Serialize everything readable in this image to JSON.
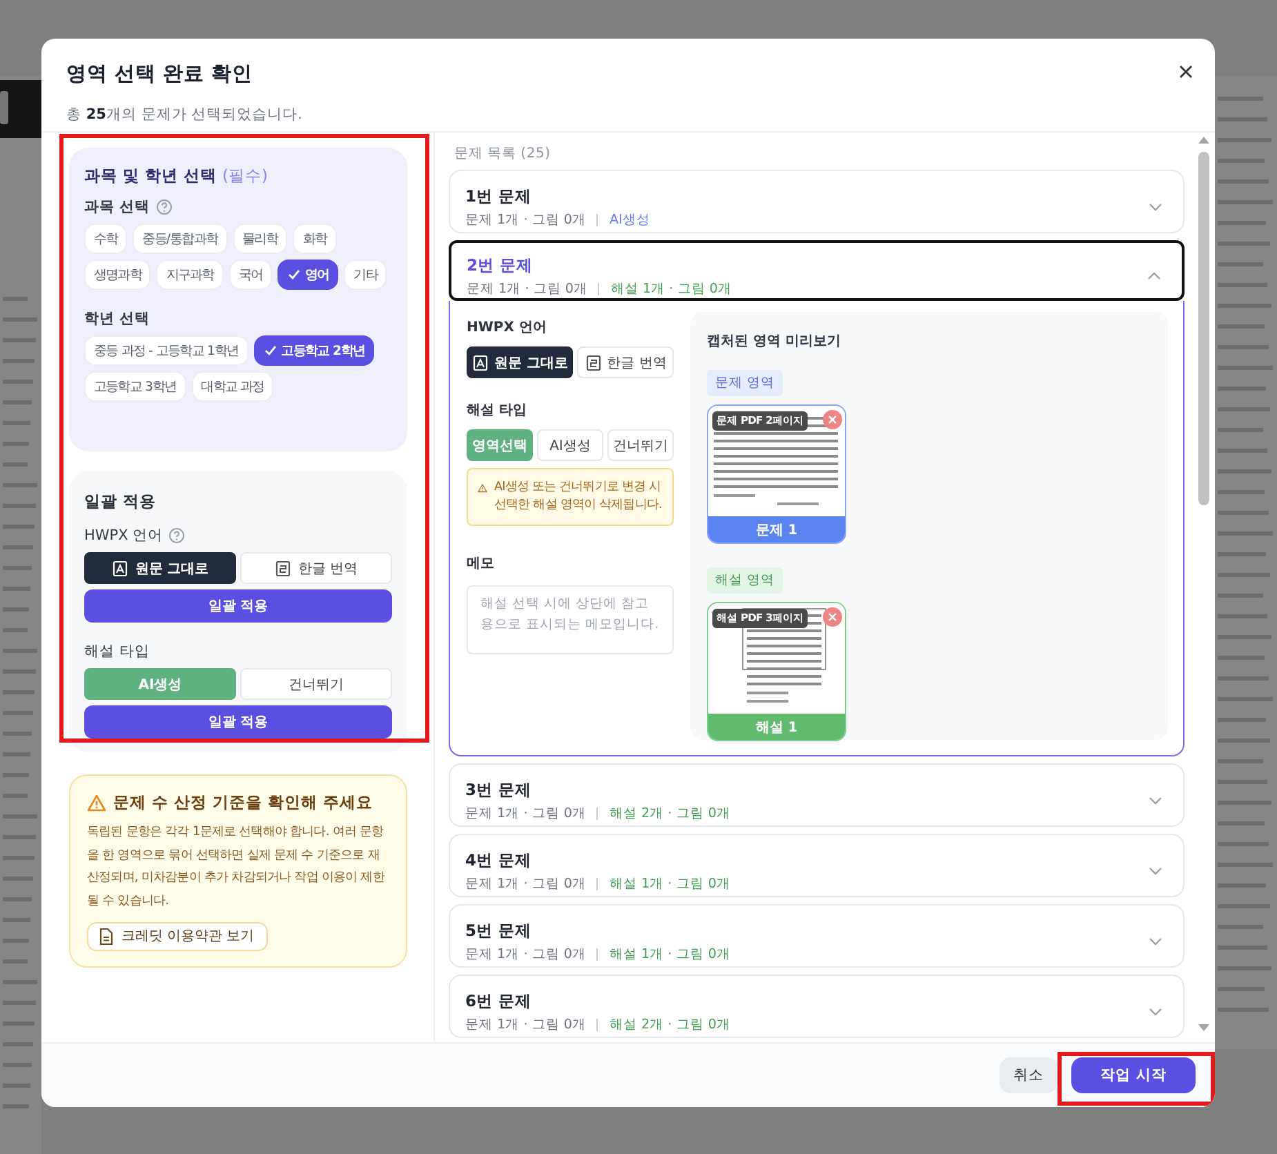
{
  "dialog": {
    "title": "영역 선택 완료 확인",
    "subtitle": "총 **25**개의 문제가 선택되었습니다."
  },
  "settings": {
    "highlighted": true,
    "title": "과목 및 학년 선택",
    "required": "(필수)",
    "subject_label": "과목 선택",
    "subjects": [
      {
        "label": "수학",
        "selected": false
      },
      {
        "label": "중등/통합과학",
        "selected": false
      },
      {
        "label": "물리학",
        "selected": false
      },
      {
        "label": "화학",
        "selected": false
      },
      {
        "label": "생명과학",
        "selected": false
      },
      {
        "label": "지구과학",
        "selected": false
      },
      {
        "label": "국어",
        "selected": false
      },
      {
        "label": "영어",
        "selected": true
      },
      {
        "label": "기타",
        "selected": false
      }
    ],
    "grade_label": "학년 선택",
    "grades": [
      {
        "label": "중등 과정 - 고등학교 1학년",
        "selected": false
      },
      {
        "label": "고등학교 2학년",
        "selected": true
      },
      {
        "label": "고등학교 3학년",
        "selected": false
      },
      {
        "label": "대학교 과정",
        "selected": false
      }
    ]
  },
  "bulk_apply": {
    "title": "일괄 적용",
    "language_label": "HWPX 언어",
    "language_options": [
      {
        "label": "원문 그대로",
        "selected": true
      },
      {
        "label": "한글 번역",
        "selected": false
      }
    ],
    "language_apply": "일괄 적용",
    "solution_label": "해설 타입",
    "solution_options": [
      {
        "label": "AI생성",
        "selected": true
      },
      {
        "label": "건너뛰기",
        "selected": false
      }
    ],
    "solution_apply": "일괄 적용"
  },
  "notice": {
    "title": "문제 수 산정 기준을 확인해 주세요",
    "body": "독립된 문항은 각각 1문제로 선택해야 합니다. 여러 문항을 한 영역으로 묶어 선택하면 실제 문제 수 기준으로 재산정되며, 미차감분이 추가 차감되거나 작업 이용이 제한될 수 있습니다.",
    "link": "크레딧 이용약관 보기"
  },
  "problem_list": {
    "title": "문제 목록 (25)",
    "problems": [
      {
        "title": "1번 문제",
        "summary": "문제 1개 · 그림 0개",
        "solution": "AI생성",
        "kind": "ai",
        "expanded": false
      },
      {
        "title": "2번 문제",
        "summary": "문제 1개 · 그림 0개",
        "solution": "해설 1개 · 그림 0개",
        "kind": "region",
        "expanded": true,
        "detail": {
          "language_label": "HWPX 언어",
          "language_options": [
            {
              "label": "원문 그대로",
              "selected": true
            },
            {
              "label": "한글 번역",
              "selected": false
            }
          ],
          "solution_label": "해설 타입",
          "solution_options": [
            {
              "label": "영역선택",
              "selected": true
            },
            {
              "label": "AI생성",
              "selected": false
            },
            {
              "label": "건너뛰기",
              "selected": false
            }
          ],
          "warning": "AI생성 또는 건너뛰기로 변경 시 선택한 해설 영역이 삭제됩니다.",
          "memo_label": "메모",
          "memo_placeholder": "해설 선택 시에 상단에 참고용으로 표시되는 메모입니다.",
          "preview": {
            "title": "캡처된 영역 미리보기",
            "groups": [
              {
                "kind": "problem",
                "tag": "문제 영역",
                "captures": [
                  {
                    "page": "문제 PDF 2페이지",
                    "label": "문제 1"
                  }
                ]
              },
              {
                "kind": "solution",
                "tag": "해설 영역",
                "captures": [
                  {
                    "page": "해설 PDF 3페이지",
                    "label": "해설 1"
                  }
                ]
              }
            ]
          }
        }
      },
      {
        "title": "3번 문제",
        "summary": "문제 1개 · 그림 0개",
        "solution": "해설 2개 · 그림 0개",
        "kind": "region",
        "expanded": false
      },
      {
        "title": "4번 문제",
        "summary": "문제 1개 · 그림 0개",
        "solution": "해설 1개 · 그림 0개",
        "kind": "region",
        "expanded": false
      },
      {
        "title": "5번 문제",
        "summary": "문제 1개 · 그림 0개",
        "solution": "해설 1개 · 그림 0개",
        "kind": "region",
        "expanded": false
      },
      {
        "title": "6번 문제",
        "summary": "문제 1개 · 그림 0개",
        "solution": "해설 2개 · 그림 0개",
        "kind": "region",
        "expanded": false
      }
    ]
  },
  "footer": {
    "cancel": "취소",
    "start": "작업 시작",
    "start_highlighted": true
  }
}
